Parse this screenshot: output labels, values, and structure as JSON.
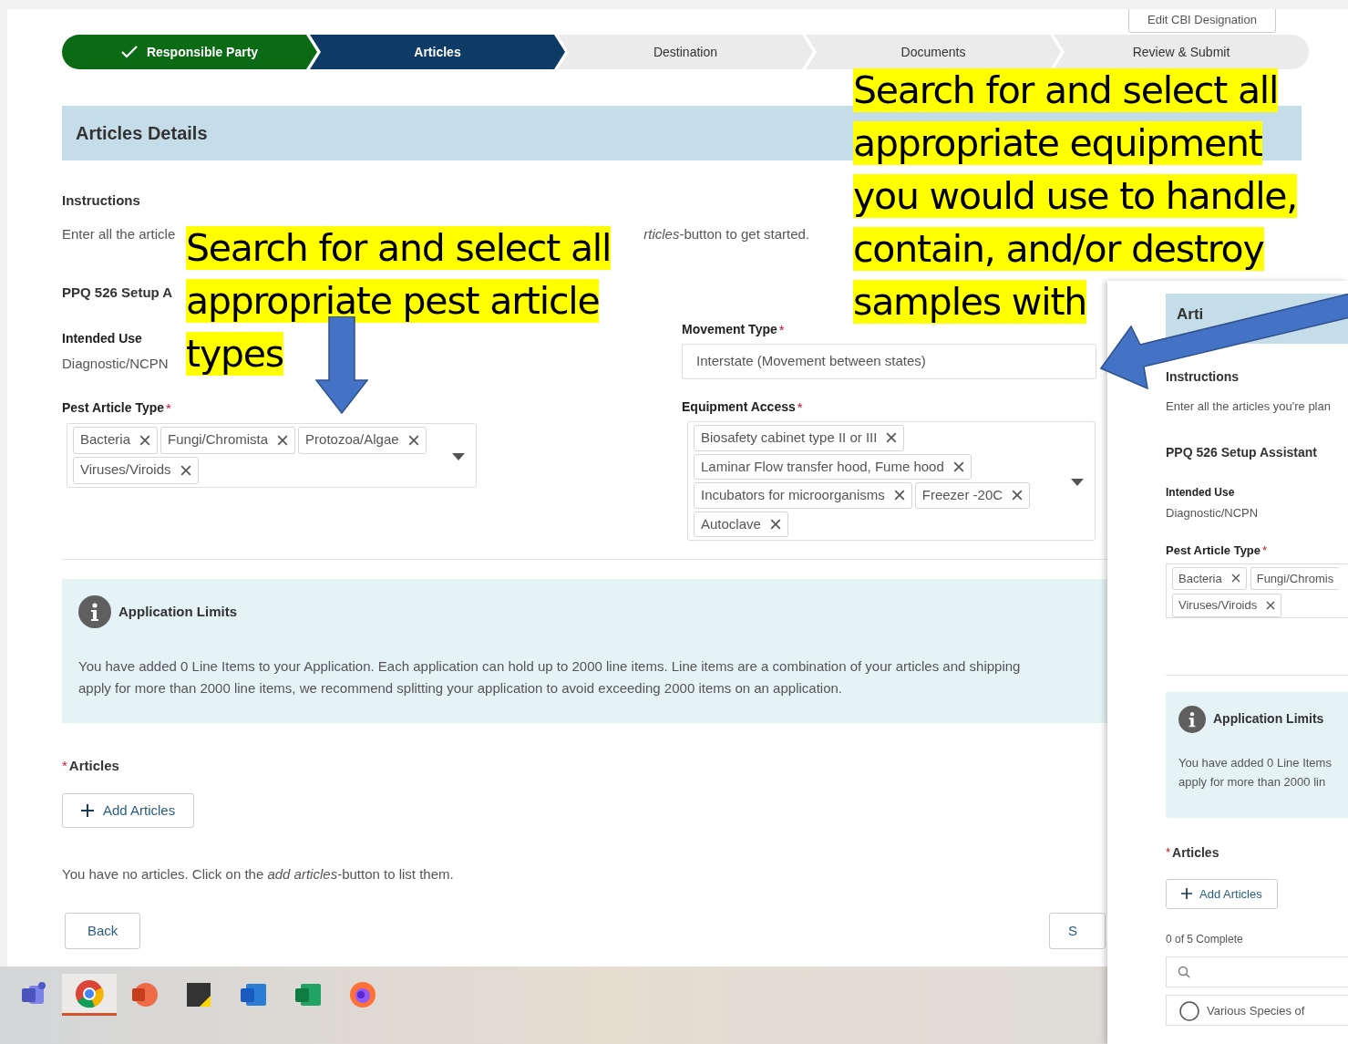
{
  "top_button": {
    "label": "Edit CBI Designation"
  },
  "stepper": [
    {
      "label": "Responsible Party",
      "completed": true,
      "selected": false
    },
    {
      "label": "Articles",
      "completed": false,
      "selected": true
    },
    {
      "label": "Destination",
      "completed": false,
      "selected": false
    },
    {
      "label": "Documents",
      "completed": false,
      "selected": false
    },
    {
      "label": "Review & Submit",
      "completed": false,
      "selected": false
    }
  ],
  "section_title": "Articles Details",
  "instructions": {
    "heading": "Instructions",
    "text_start": "Enter all the article",
    "text_end": "*rticles*-button to get started."
  },
  "setup_heading": "PPQ 526 Setup A",
  "intended_use": {
    "label": "Intended Use",
    "value": "Diagnostic/NCPN"
  },
  "pest_article_type": {
    "label": "Pest Article Type",
    "required_mark": "*",
    "tags": [
      "Bacteria",
      "Fungi/Chromista",
      "Protozoa/Algae",
      "Viruses/Viroids"
    ]
  },
  "movement_type": {
    "label": "Movement Type",
    "required_mark": "*",
    "value": "Interstate (Movement between states)"
  },
  "equipment_access": {
    "label": "Equipment Access",
    "required_mark": "*",
    "tags": [
      "Biosafety cabinet type II or III",
      "Laminar Flow transfer hood, Fume hood",
      "Incubators for microorganisms",
      "Freezer -20C",
      "Autoclave"
    ]
  },
  "application_limits": {
    "title": "Application Limits",
    "lines": [
      "You have added 0 Line Items to your Application. Each application can hold up to 2000 line items. Line items are a combination of your articles and shipping",
      "apply for more than 2000 line items, we recommend splitting your application to avoid exceeding 2000 items on an application."
    ]
  },
  "articles": {
    "label": "Articles",
    "required_mark": "*",
    "add_button": "Add Articles",
    "empty_text": "You have no articles. Click on the *add articles*-button to list them."
  },
  "buttons": {
    "back": "Back",
    "next": "S"
  },
  "inset_panel": {
    "heading": "Arti",
    "instructions_heading": "Instructions",
    "instructions_text": "Enter all the articles you're plan",
    "setup_heading": "PPQ 526 Setup Assistant",
    "intended_use_label": "Intended Use",
    "intended_use_value": "Diagnostic/NCPN",
    "pest_label": "Pest Article Type",
    "pest_required_mark": "*",
    "tags": [
      "Bacteria",
      "Fungi/Chromis",
      "Viruses/Viroids"
    ],
    "limits_title": "Application Limits",
    "limits_lines": [
      "You have added 0 Line Items",
      "apply for more than 2000 lin"
    ],
    "articles_label": "Articles",
    "articles_required_mark": "*",
    "add_button": "Add Articles",
    "progress": "0 of 5 Complete",
    "list_item": "Various Species of"
  },
  "taskbar": [
    {
      "kind": "teams",
      "selected": false
    },
    {
      "kind": "chrome",
      "selected": true
    },
    {
      "kind": "powerpoint",
      "selected": false
    },
    {
      "kind": "notes",
      "selected": false
    },
    {
      "kind": "word",
      "selected": false
    },
    {
      "kind": "excel",
      "selected": false
    },
    {
      "kind": "firefox",
      "selected": false
    }
  ],
  "callouts": [
    {
      "text": "Search for and select all appropriate pest article types"
    },
    {
      "text": "Search for and select all appropriate equipment you would use to handle, contain, and/or destroy samples with"
    }
  ]
}
